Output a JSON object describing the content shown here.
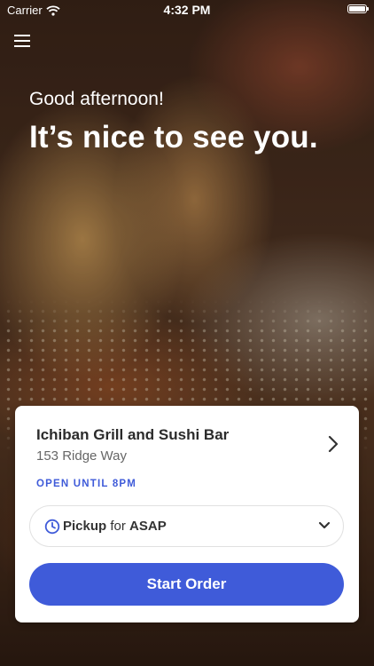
{
  "status_bar": {
    "carrier": "Carrier",
    "time": "4:32 PM"
  },
  "hero": {
    "greeting": "Good afternoon!",
    "headline": "It’s nice to see you."
  },
  "store": {
    "name": "Ichiban Grill and Sushi Bar",
    "address": "153 Ridge Way",
    "hours_status": "OPEN UNTIL 8PM"
  },
  "order_options": {
    "mode": "Pickup",
    "connector": "for",
    "time": "ASAP"
  },
  "actions": {
    "start_order": "Start Order"
  },
  "colors": {
    "accent": "#3f5bd9",
    "card": "#ffffff",
    "text": "#2b2b2b"
  },
  "icons": [
    "wifi-icon",
    "battery-icon",
    "menu-icon",
    "chevron-right-icon",
    "clock-icon",
    "chevron-down-icon"
  ]
}
